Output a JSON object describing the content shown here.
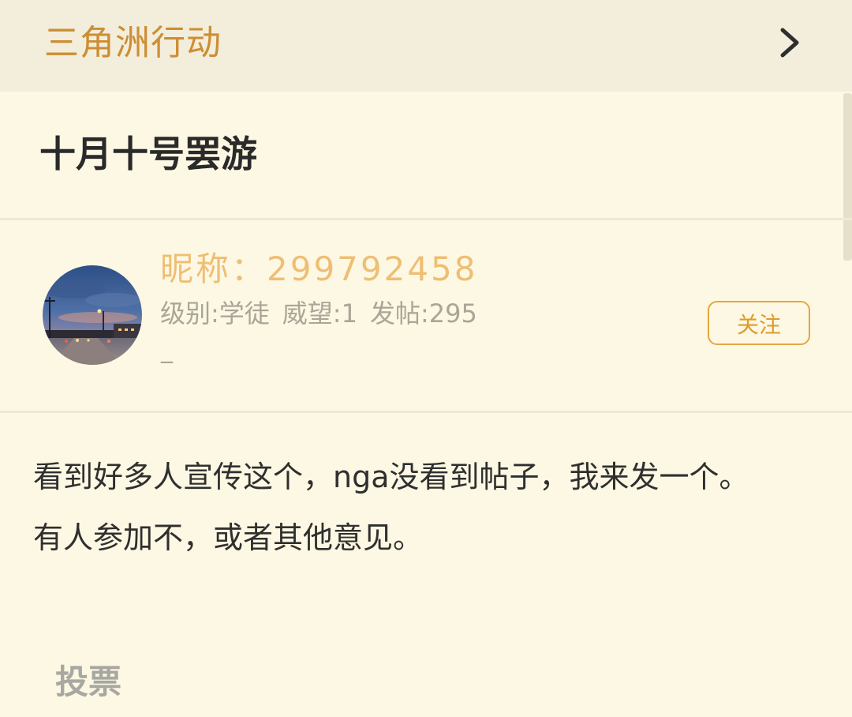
{
  "forum": {
    "name": "三角洲行动",
    "chevron_icon": "chevron-right-icon"
  },
  "thread": {
    "title": "十月十号罢游"
  },
  "author": {
    "nickname": "昵称：299792458",
    "level": "级别:学徒",
    "prestige": "威望:1",
    "posts": "发帖:295",
    "signature": "_",
    "avatar_icon": "avatar-photo-dusk-street",
    "follow_label": "关注"
  },
  "post": {
    "paragraphs": [
      "看到好多人宣传这个，nga没看到帖子，我来发一个。",
      "有人参加不，或者其他意见。"
    ]
  },
  "vote": {
    "heading": "投票"
  },
  "colors": {
    "background": "#fdf8e3",
    "forum_bar": "#f3eedc",
    "forum_name": "#cd8e33",
    "nickname": "#efbe74",
    "accent": "#e5a742",
    "muted_text": "#a9a598"
  }
}
